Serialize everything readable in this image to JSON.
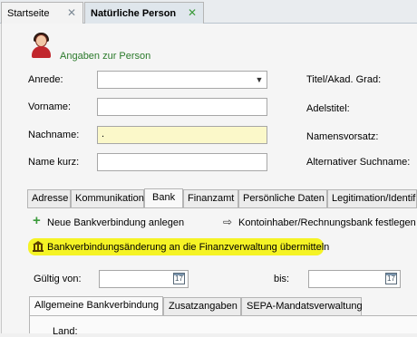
{
  "doc_tabs": [
    {
      "label": "Startseite"
    },
    {
      "label": "Natürliche Person"
    }
  ],
  "section": {
    "title": "Angaben zur Person"
  },
  "fields": {
    "anrede": {
      "label": "Anrede:",
      "value": ""
    },
    "vorname": {
      "label": "Vorname:",
      "value": ""
    },
    "nachname": {
      "label": "Nachname:",
      "value": "."
    },
    "name_kurz": {
      "label": "Name kurz:",
      "value": ""
    },
    "titel": {
      "label": "Titel/Akad. Grad:"
    },
    "adelstitel": {
      "label": "Adelstitel:"
    },
    "namensvorsatz": {
      "label": "Namensvorsatz:"
    },
    "alt_suchname": {
      "label": "Alternativer Suchname:"
    }
  },
  "sub_tabs": [
    {
      "label": "Adresse"
    },
    {
      "label": "Kommunikation"
    },
    {
      "label": "Bank"
    },
    {
      "label": "Finanzamt"
    },
    {
      "label": "Persönliche Daten"
    },
    {
      "label": "Legitimation/Identifi"
    }
  ],
  "actions": {
    "new_bank": "Neue Bankverbindung anlegen",
    "account_holder": "Kontoinhaber/Rechnungsbank festlegen",
    "transmit": "Bankverbindungsänderung an die Finanzverwaltung übermitteln"
  },
  "validity": {
    "from_label": "Gültig von:",
    "from_value": "",
    "to_label": "bis:",
    "to_value": "",
    "calendar_glyph": "17"
  },
  "bank_tabs": [
    {
      "label": "Allgemeine Bankverbindung"
    },
    {
      "label": "Zusatzangaben"
    },
    {
      "label": "SEPA-Mandatsverwaltung"
    }
  ],
  "cut_label": "Land:",
  "colors": {
    "highlight": "#f5f200",
    "accent_green": "#2b7a2b",
    "input_yellow": "#fbf8c9"
  }
}
